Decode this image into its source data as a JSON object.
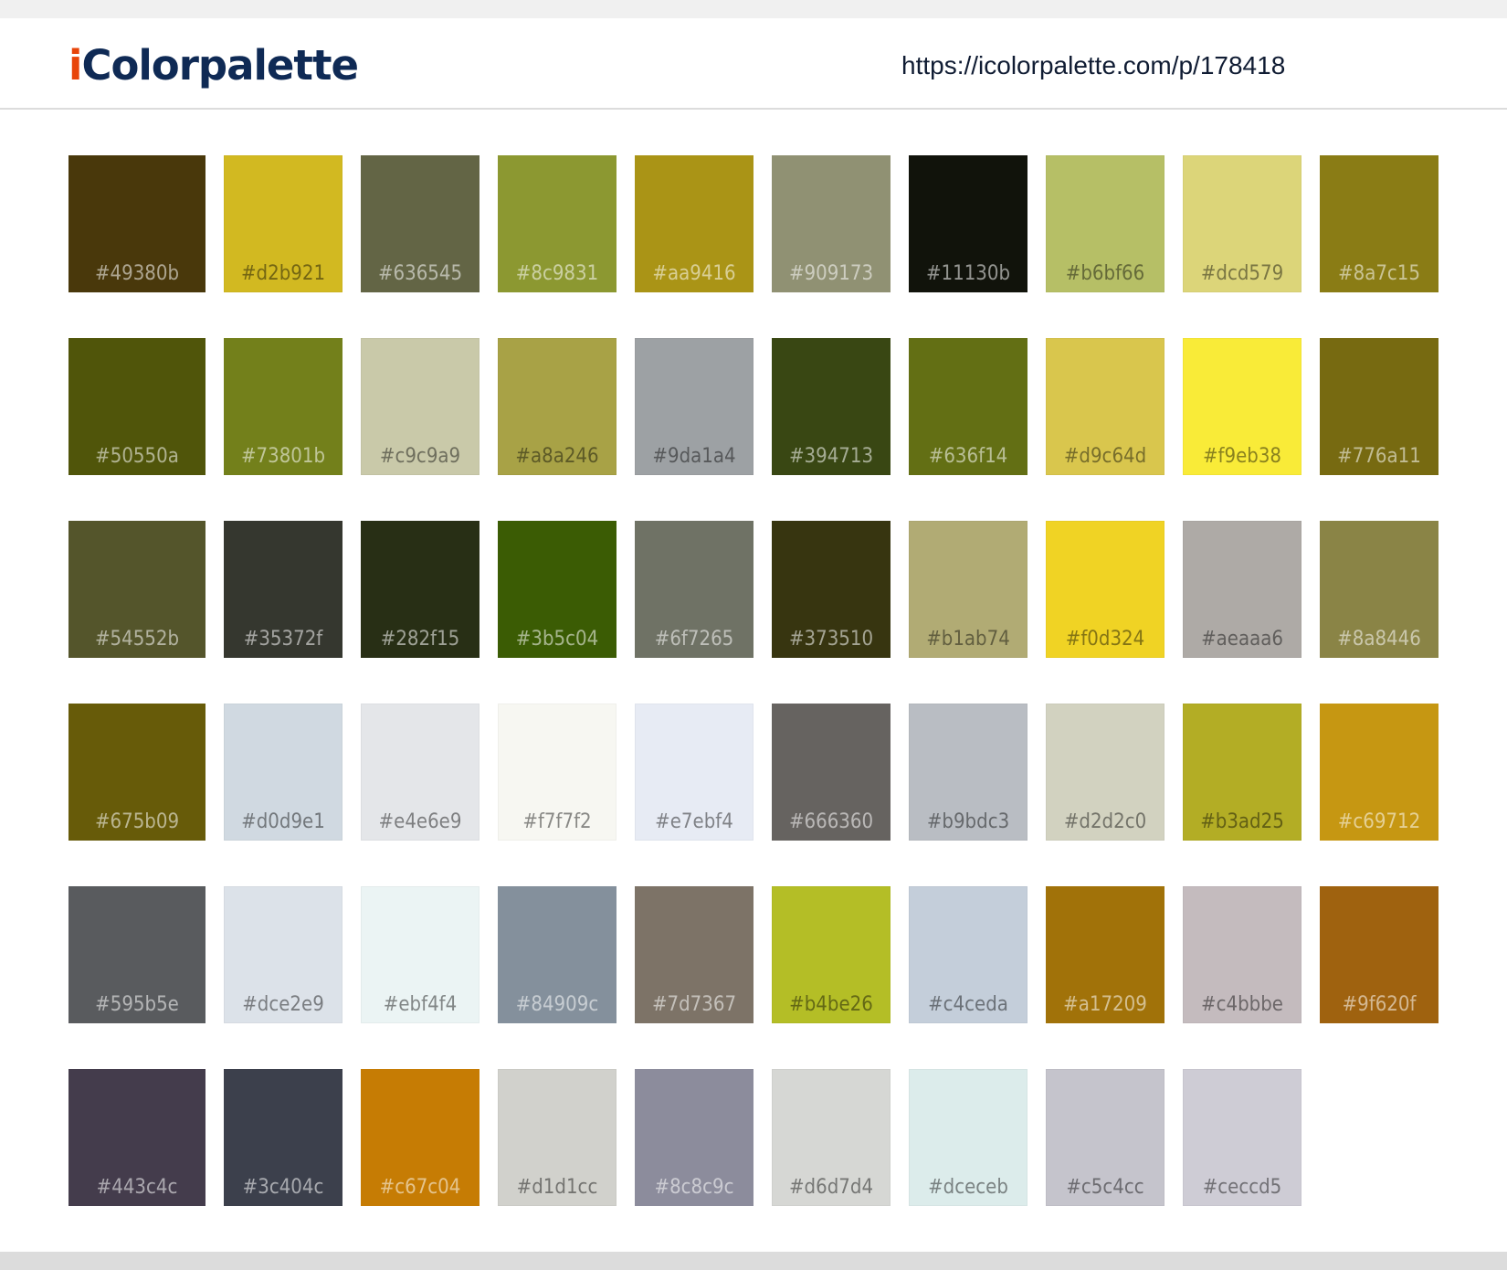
{
  "header": {
    "logo_accent": "i",
    "logo_rest": "Colorpalette",
    "url": "https://icolorpalette.com/p/178418"
  },
  "colors": {
    "logo_accent": "#e8450a",
    "logo_text": "#0f2a55",
    "page_bg": "#f0f0f0",
    "content_bg": "#ffffff"
  },
  "palette": [
    "#49380b",
    "#d2b921",
    "#636545",
    "#8c9831",
    "#aa9416",
    "#909173",
    "#11130b",
    "#b6bf66",
    "#dcd579",
    "#8a7c15",
    "#50550a",
    "#73801b",
    "#c9c9a9",
    "#a8a246",
    "#9da1a4",
    "#394713",
    "#636f14",
    "#d9c64d",
    "#f9eb38",
    "#776a11",
    "#54552b",
    "#35372f",
    "#282f15",
    "#3b5c04",
    "#6f7265",
    "#373510",
    "#b1ab74",
    "#f0d324",
    "#aeaaa6",
    "#8a8446",
    "#675b09",
    "#d0d9e1",
    "#e4e6e9",
    "#f7f7f2",
    "#e7ebf4",
    "#666360",
    "#b9bdc3",
    "#d2d2c0",
    "#b3ad25",
    "#c69712",
    "#595b5e",
    "#dce2e9",
    "#ebf4f4",
    "#84909c",
    "#7d7367",
    "#b4be26",
    "#c4ceda",
    "#a17209",
    "#c4bbbe",
    "#9f620f",
    "#443c4c",
    "#3c404c",
    "#c67c04",
    "#d1d1cc",
    "#8c8c9c",
    "#d6d7d4",
    "#dceceb",
    "#c5c4cc",
    "#ceccd5"
  ]
}
